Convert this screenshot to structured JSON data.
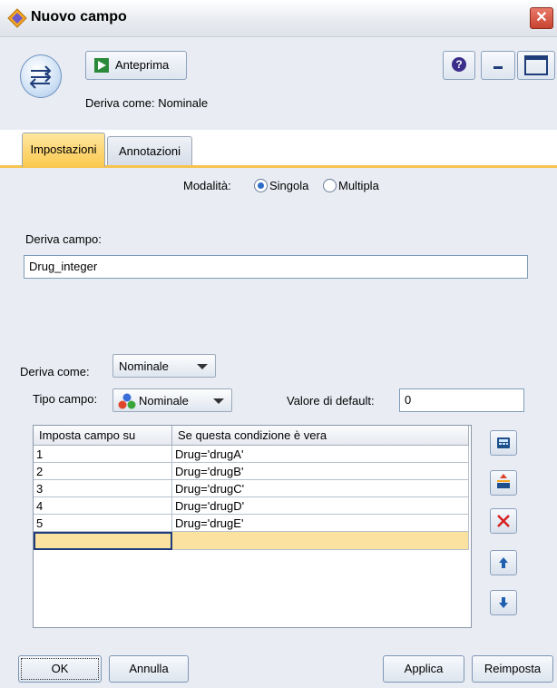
{
  "window": {
    "title": "Nuovo campo",
    "close_glyph": "✕"
  },
  "toolbar": {
    "preview_label": "Anteprima",
    "help_glyph": "?",
    "derive_summary": "Deriva come: Nominale"
  },
  "tabs": [
    {
      "label": "Impostazioni",
      "active": true
    },
    {
      "label": "Annotazioni",
      "active": false
    }
  ],
  "mode": {
    "label": "Modalità:",
    "options": [
      {
        "label": "Singola",
        "checked": true
      },
      {
        "label": "Multipla",
        "checked": false
      }
    ]
  },
  "derive_field": {
    "label": "Deriva campo:",
    "value": "Drug_integer"
  },
  "derive_as": {
    "label": "Deriva come:",
    "value": "Nominale"
  },
  "field_type": {
    "label": "Tipo campo:",
    "value": "Nominale"
  },
  "default_value": {
    "label": "Valore di default:",
    "value": "0"
  },
  "conditions_table": {
    "columns": [
      "Imposta campo su",
      "Se questa condizione è vera"
    ],
    "rows": [
      [
        "1",
        "Drug='drugA'"
      ],
      [
        "2",
        "Drug='drugB'"
      ],
      [
        "3",
        "Drug='drugC'"
      ],
      [
        "4",
        "Drug='drugD'"
      ],
      [
        "5",
        "Drug='drugE'"
      ]
    ]
  },
  "side_buttons": [
    "expression-builder-icon",
    "insert-row-icon",
    "delete-icon",
    "move-up-icon",
    "move-down-icon"
  ],
  "buttons": {
    "ok": "OK",
    "cancel": "Annulla",
    "apply": "Applica",
    "reset": "Reimposta"
  },
  "colors": {
    "accent_tab": "#fbc94e",
    "selected_row": "#fbe2a0",
    "panel_bg": "#e9edf3"
  }
}
